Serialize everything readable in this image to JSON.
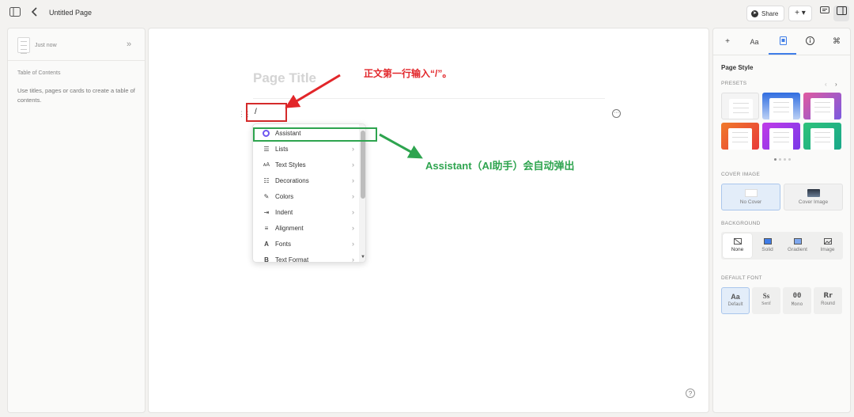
{
  "topbar": {
    "title": "Untitled Page",
    "share_label": "Share",
    "plus_label": "+ ▾"
  },
  "left_panel": {
    "timestamp": "Just now",
    "toc_title": "Table of Contents",
    "toc_hint": "Use titles, pages or cards to create a table of contents."
  },
  "editor": {
    "page_title_placeholder": "Page Title",
    "input_text": "/",
    "slash_menu": {
      "items": [
        {
          "label": "Assistant",
          "icon": "ai-assistant-icon"
        },
        {
          "label": "Lists",
          "icon": "list-icon"
        },
        {
          "label": "Text Styles",
          "icon": "text-styles-icon"
        },
        {
          "label": "Decorations",
          "icon": "decorations-icon"
        },
        {
          "label": "Colors",
          "icon": "paint-brush-icon"
        },
        {
          "label": "Indent",
          "icon": "indent-icon"
        },
        {
          "label": "Alignment",
          "icon": "align-left-icon"
        },
        {
          "label": "Fonts",
          "icon": "font-icon"
        },
        {
          "label": "Text Format",
          "icon": "bold-icon"
        }
      ]
    }
  },
  "annotations": {
    "red_text": "正文第一行输入“/”。",
    "green_text": "Assistant（AI助手）会自动弹出",
    "red_color": "#e2262a",
    "green_color": "#2ea44f"
  },
  "right_panel": {
    "tabs": [
      "+",
      "Aa",
      "page-style-icon",
      "info-icon",
      "⌘"
    ],
    "heading": "Page Style",
    "presets_label": "PRESETS",
    "cover_label": "COVER IMAGE",
    "cover_options": [
      "No Cover",
      "Cover Image"
    ],
    "background_label": "BACKGROUND",
    "background_options": [
      "None",
      "Solid",
      "Gradient",
      "Image"
    ],
    "font_label": "DEFAULT FONT",
    "font_options": [
      {
        "sample": "Aa",
        "name": "Default"
      },
      {
        "sample": "Ss",
        "name": "Serif"
      },
      {
        "sample": "00",
        "name": "Mono"
      },
      {
        "sample": "Rr",
        "name": "Round"
      }
    ],
    "accent_color": "#3f7de8"
  }
}
